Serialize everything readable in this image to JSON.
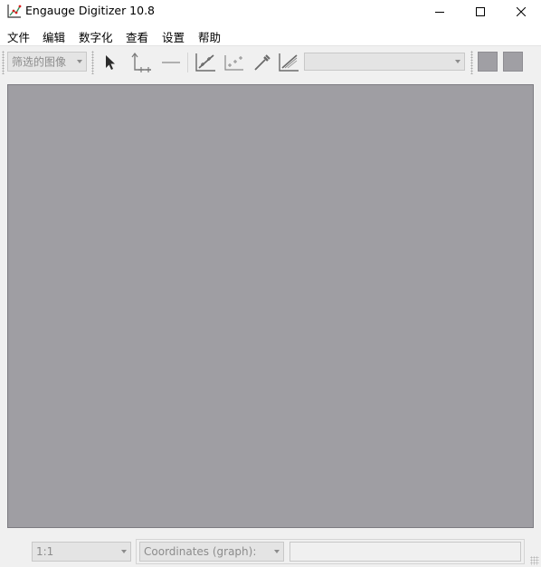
{
  "window": {
    "title": "Engauge Digitizer 10.8",
    "minimize_icon": "minimize-icon",
    "maximize_icon": "maximize-icon",
    "close_icon": "close-icon"
  },
  "menu": {
    "items": [
      "文件",
      "编辑",
      "数字化",
      "查看",
      "设置",
      "帮助"
    ]
  },
  "toolbar": {
    "filter_combo_value": "筛选的图像",
    "curve_combo_value": "",
    "tools": [
      "select-arrow-icon",
      "axis-point-icon",
      "scale-bar-icon",
      "curve-point-icon",
      "point-match-icon",
      "color-picker-icon",
      "segment-fill-icon"
    ]
  },
  "statusbar": {
    "zoom_value": "1:1",
    "coords_combo_value": "Coordinates (graph):",
    "coords_value": ""
  },
  "colors": {
    "canvas_background": "#9f9ea3",
    "window_background": "#f0f0f0"
  }
}
